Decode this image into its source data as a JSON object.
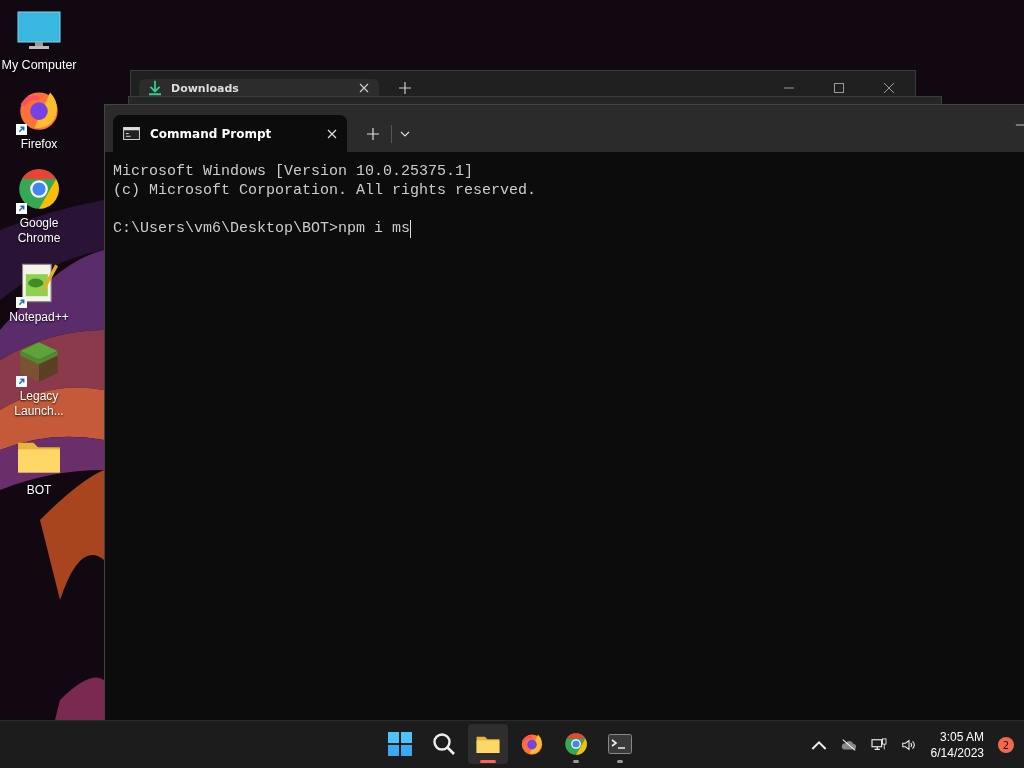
{
  "desktop_icons": [
    {
      "kind": "computer",
      "label": "My Computer",
      "shortcut": false
    },
    {
      "kind": "firefox",
      "label": "Firefox",
      "shortcut": true
    },
    {
      "kind": "chrome",
      "label": "Google Chrome",
      "shortcut": true
    },
    {
      "kind": "notepad",
      "label": "Notepad++",
      "shortcut": true
    },
    {
      "kind": "block",
      "label": "Legacy Launch...",
      "shortcut": true
    },
    {
      "kind": "folder",
      "label": "BOT",
      "shortcut": false
    }
  ],
  "background_window": {
    "tab_title": "Downloads"
  },
  "terminal": {
    "tab_title": "Command Prompt",
    "lines": [
      "Microsoft Windows [Version 10.0.25375.1]",
      "(c) Microsoft Corporation. All rights reserved."
    ],
    "prompt": "C:\\Users\\vm6\\Desktop\\BOT>npm i ms"
  },
  "taskbar": {
    "apps": [
      {
        "kind": "start",
        "running": false,
        "active": false
      },
      {
        "kind": "search",
        "running": false,
        "active": false
      },
      {
        "kind": "folder",
        "running": true,
        "active": true
      },
      {
        "kind": "firefox",
        "running": false,
        "active": false
      },
      {
        "kind": "chrome",
        "running": true,
        "active": false
      },
      {
        "kind": "terminal",
        "running": true,
        "active": false
      }
    ],
    "clock": {
      "time": "3:05 AM",
      "date": "6/14/2023"
    },
    "notifications": "2"
  }
}
